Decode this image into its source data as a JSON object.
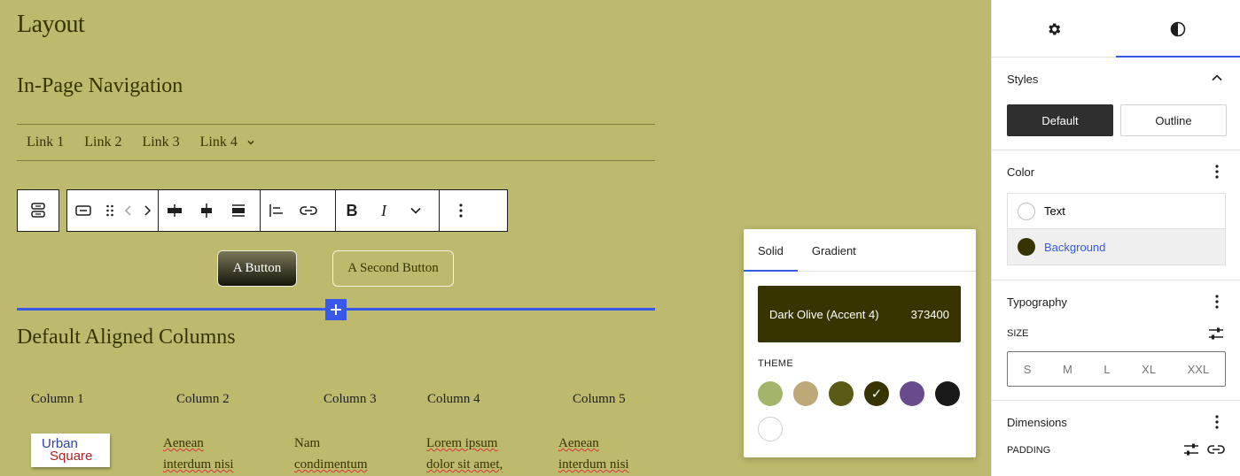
{
  "canvas": {
    "title": "Layout",
    "nav_heading": "In-Page Navigation",
    "nav_links": [
      "Link 1",
      "Link 2",
      "Link 3",
      "Link 4"
    ],
    "buttons": {
      "primary": "A Button",
      "secondary": "A Second Button"
    },
    "columns_heading": "Default Aligned Columns",
    "column_headers": [
      "Column 1",
      "Column 2",
      "Column 3",
      "Column 4",
      "Column 5"
    ],
    "logo": {
      "line1": "Urban",
      "line2": "Square"
    },
    "column_texts": [
      [
        "Aenean",
        "interdum nisi"
      ],
      [
        "Nam",
        "condimentum"
      ],
      [
        "Lorem ipsum",
        "dolor sit amet,"
      ],
      [
        "Aenean",
        "interdum nisi"
      ]
    ]
  },
  "popover": {
    "tabs": [
      "Solid",
      "Gradient"
    ],
    "selected_name": "Dark Olive (Accent 4)",
    "selected_hex": "373400",
    "selected_color": "#373400",
    "theme_label": "Theme",
    "theme_colors": [
      "#a3b56b",
      "#bda878",
      "#5a5a14",
      "#373400",
      "#684b8c",
      "#19191a",
      "#ffffff"
    ],
    "check_glyph": "✓"
  },
  "sidebar": {
    "styles_title": "Styles",
    "style_default": "Default",
    "style_outline": "Outline",
    "color_title": "Color",
    "color_text": "Text",
    "color_background": "Background",
    "typography_title": "Typography",
    "size_label": "Size",
    "sizes": [
      "S",
      "M",
      "L",
      "XL",
      "XXL"
    ],
    "dimensions_title": "Dimensions",
    "padding_label": "Padding",
    "accent": "#3858e9"
  }
}
